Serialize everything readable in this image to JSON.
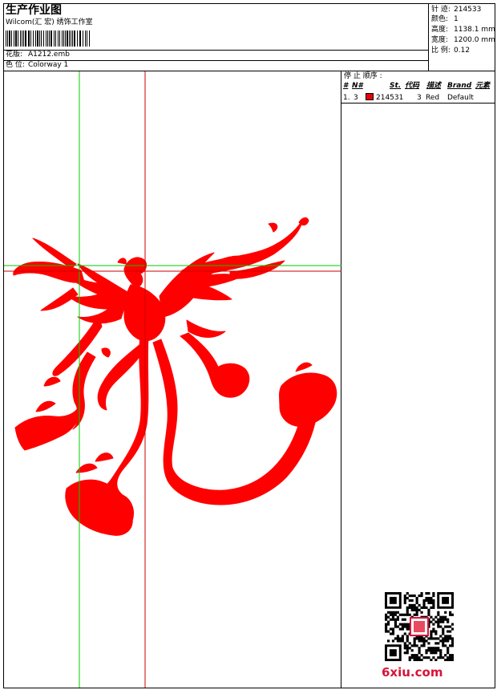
{
  "header": {
    "title": "生产作业图",
    "studio": "Wilcom(汇 宏) 绣饰工作室"
  },
  "design_info": {
    "pattern_label": "花版:",
    "pattern_value": "A1212.emb",
    "colorway_label": "色 位:",
    "colorway_value": "Colorway 1"
  },
  "stats": [
    {
      "label": "针 迹:",
      "value": "214533"
    },
    {
      "label": "颜色:",
      "value": "1"
    },
    {
      "label": "高度:",
      "value": "1138.1 mm"
    },
    {
      "label": "宽度:",
      "value": "1200.0 mm"
    },
    {
      "label": "比 例:",
      "value": "0.12"
    }
  ],
  "stop_sequence": {
    "title": "停 止 顺序 :",
    "columns": [
      "#",
      "N#",
      "St.",
      "代码",
      "描述",
      "Brand",
      "元素"
    ],
    "rows": [
      {
        "index": "1.",
        "n": "3",
        "color": "#e8000b",
        "st": "214531",
        "code": "3",
        "desc": "Red",
        "brand": "Default"
      }
    ]
  },
  "colors": {
    "design_fill": "#ff0000",
    "crosshair_green": "#00cc00",
    "crosshair_red": "#cc0000",
    "watermark": "#d8143a"
  },
  "watermark": "6xiu.com"
}
